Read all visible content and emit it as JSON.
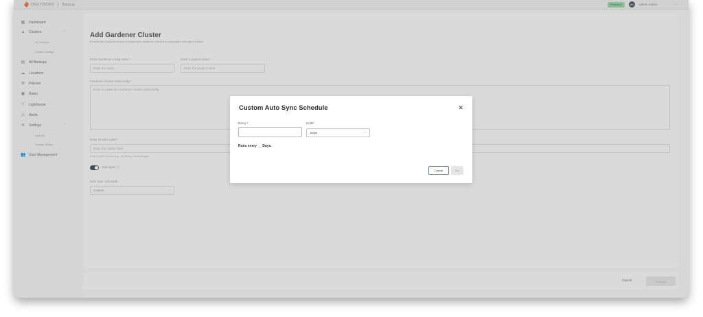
{
  "app": {
    "brand": "DIGITWORX",
    "module": "Backup",
    "status_badge": "Protected",
    "user_initials": "AD",
    "user_name": "admin Admin",
    "menu_icon": "kebab-icon"
  },
  "sidebar": {
    "items": [
      {
        "label": "Dashboard",
        "icon": "grid-icon"
      },
      {
        "label": "Clusters",
        "icon": "cluster-icon"
      },
      {
        "label": "All Clusters"
      },
      {
        "label": "Cluster Configs"
      },
      {
        "label": "All Backups",
        "icon": "backup-icon"
      },
      {
        "label": "Locations",
        "icon": "cloud-icon"
      },
      {
        "label": "Policies",
        "icon": "policy-icon"
      },
      {
        "label": "Rules",
        "icon": "rules-icon"
      },
      {
        "label": "Lighthouse",
        "icon": "lighthouse-icon"
      },
      {
        "label": "Alerts",
        "icon": "alert-icon"
      },
      {
        "label": "Settings",
        "icon": "gear-icon"
      },
      {
        "label": "License"
      },
      {
        "label": "Service Status"
      },
      {
        "label": "User Management",
        "icon": "users-icon"
      }
    ]
  },
  "page": {
    "title": "Add Gardener Cluster",
    "description": "Provide the Gardener cluster configuration details to onboard to associated managed clusters",
    "config_name_label": "Enter Gardener config name *",
    "config_name_placeholder": "Enter the name",
    "project_name_label": "Enter a project name *",
    "project_name_placeholder": "Enter the project name",
    "kubeconfig_label": "Gardener Cluster kubeconfig *",
    "kubeconfig_placeholder": "Enter or paste the Gardener Cluster Kubeconfig",
    "cluster_label_label": "Enter Cluster Label *",
    "cluster_label_placeholder": "Enter the cluster label",
    "cluster_label_hint": "Enter a valid K8s label (e.g., px-backup, dev/test/stage)",
    "auto_sync_label": "Auto Sync",
    "schedule_label": "Auto Sync Schedule",
    "schedule_value": "Custom"
  },
  "footer": {
    "cancel_label": "Cancel",
    "submit_label": "Continue"
  },
  "modal": {
    "title": "Custom Auto Sync Schedule",
    "every_label": "Every *",
    "every_value": "",
    "units_label": "Units*",
    "units_value": "Days",
    "runs_text": "Runs every __ Days.",
    "cancel_label": "Cancel",
    "set_label": "Set"
  }
}
